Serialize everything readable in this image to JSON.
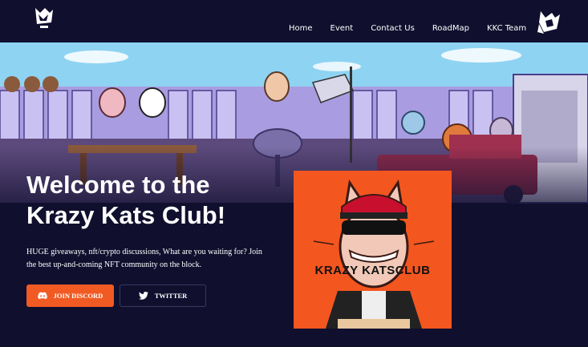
{
  "nav": {
    "links": [
      "Home",
      "Event",
      "Contact Us",
      "RoadMap",
      "KKC Team"
    ]
  },
  "hero": {
    "title_line1": "Welcome to the",
    "title_line2": "Krazy Kats Club!",
    "description": "HUGE giveaways, nft/crypto discussions, What are you waiting for? Join the best up-and-coming NFT community on the block.",
    "discord_label": "JOIN DISCORD",
    "twitter_label": "TWITTER"
  },
  "card": {
    "title": "KRAZY KATSCLUB"
  },
  "icons": {
    "discord": "discord-icon",
    "twitter": "twitter-icon"
  },
  "colors": {
    "background": "#100f2e",
    "accent": "#f15a22",
    "card": "#f4561f",
    "sky": "#8fd3f2"
  }
}
